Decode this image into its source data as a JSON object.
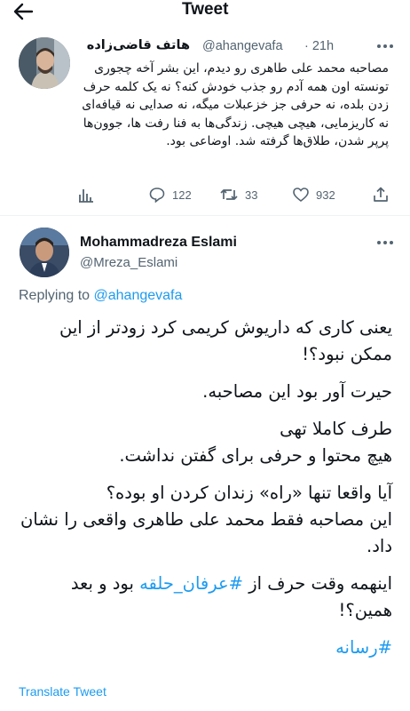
{
  "header": {
    "title": "Tweet",
    "back_icon": "arrow-left-icon"
  },
  "quoted_tweet": {
    "display_name": "هاتف قاضی‌زاده",
    "handle": "@ahangevafa",
    "time": "· 21h",
    "text": "مصاحبه محمد علی طاهری رو دیدم، این بشر آخه چجوری تونسته اون همه آدم رو جذب خودش کنه؟ نه یک کلمه حرف زدن بلده، نه حرفی جز خزعبلات میگه، نه صدایی نه قیافه‌ای نه کاریزمایی، هیچی هیچی. زندگی‌ها به فنا رفت ها، جوون‌ها پرپر شدن، طلاق‌ها گرفته شد. اوضاعی بود.",
    "actions": {
      "analytics_icon": "bar-chart-icon",
      "reply_count": "122",
      "retweet_count": "33",
      "like_count": "932",
      "share_icon": "share-icon"
    }
  },
  "reply": {
    "display_name": "Mohammadreza Eslami",
    "handle": "@Mreza_Eslami",
    "replying_prefix": "Replying to ",
    "replying_to": "@ahangevafa",
    "paragraphs": [
      "یعنی کاری که داریوش کریمی کرد زودتر از این ممکن نبود؟!",
      "حیرت آور بود این مصاحبه.",
      "طرف کاملا تهی",
      "هیچ محتوا و حرفی برای گفتن نداشت.",
      "آیا واقعا تنها «راه» زندان کردن او بوده؟",
      "این مصاحبه فقط محمد علی طاهری واقعی را نشان داد."
    ],
    "last_before": "اینهمه وقت حرف از ",
    "hashtag1": "#عرفان_حلقه",
    "last_after": " بود و بعد همین؟!",
    "hashtag2": "#رسانه",
    "translate": "Translate Tweet"
  }
}
